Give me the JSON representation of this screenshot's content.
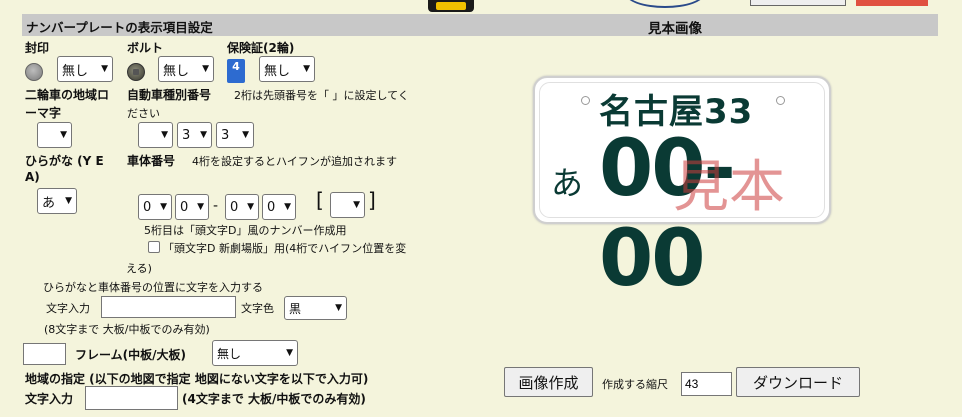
{
  "header": {
    "left_title": "ナンバープレートの表示項目設定",
    "right_title": "見本画像"
  },
  "row1": {
    "seal_label": "封印",
    "bolt_label": "ボルト",
    "insurance_label": "保険証(2輪)",
    "seal_value": "無し",
    "bolt_value": "無し",
    "insurance_value": "無し",
    "insurance_icon_glyph": "4"
  },
  "row2": {
    "region_label_line1": "二輪車の地域ロ",
    "region_label_line2": "ーマ字",
    "type_label": "自動車種別番号",
    "type_note_line1": "2桁は先頭番号を「 」に設定してく",
    "type_note_line2": "ださい",
    "region_value": "",
    "type_values": [
      "",
      "3",
      "3"
    ]
  },
  "row3": {
    "hiragana_label_line1": "ひらがな (Y E",
    "hiragana_label_line2": "A)",
    "body_label": "車体番号",
    "body_note": "4桁を設定するとハイフンが追加されます",
    "hiragana_value": "あ",
    "body_values": [
      "0",
      "0",
      "0",
      "0"
    ],
    "dash": "-",
    "extra_value": "",
    "bracket_open": "[",
    "bracket_close": "]"
  },
  "notes": {
    "fifth_digit": "5桁目は「頭文字D」風のナンバー作成用",
    "movie_checkbox_line1": "「頭文字D 新劇場版」用(4桁でハイフン位置を変",
    "movie_checkbox_line2": "える)",
    "position_note": "ひらがなと車体番号の位置に文字を入力する",
    "char_input_label": "文字入力",
    "char_color_label": "文字色",
    "char_color_value": "黒",
    "char_limit_note": "(8文字まで 大板/中板でのみ有効)"
  },
  "frame": {
    "label": "フレーム(中板/大板)",
    "value": "無し"
  },
  "region_spec": {
    "label": "地域の指定 (以下の地図で指定 地図にない文字を以下で入力可)",
    "input_label": "文字入力",
    "input_note": "(4文字まで 大板/中板でのみ有効)"
  },
  "plate_preview": {
    "region_text": "名古屋33",
    "kana": "あ",
    "number": "00-00",
    "watermark": "見本",
    "text_color": "#0a3a34",
    "watermark_color": "#cc3c3c"
  },
  "actions": {
    "create_button": "画像作成",
    "scale_label": "作成する縮尺",
    "scale_value": "43",
    "download_button": "ダウンロード"
  }
}
